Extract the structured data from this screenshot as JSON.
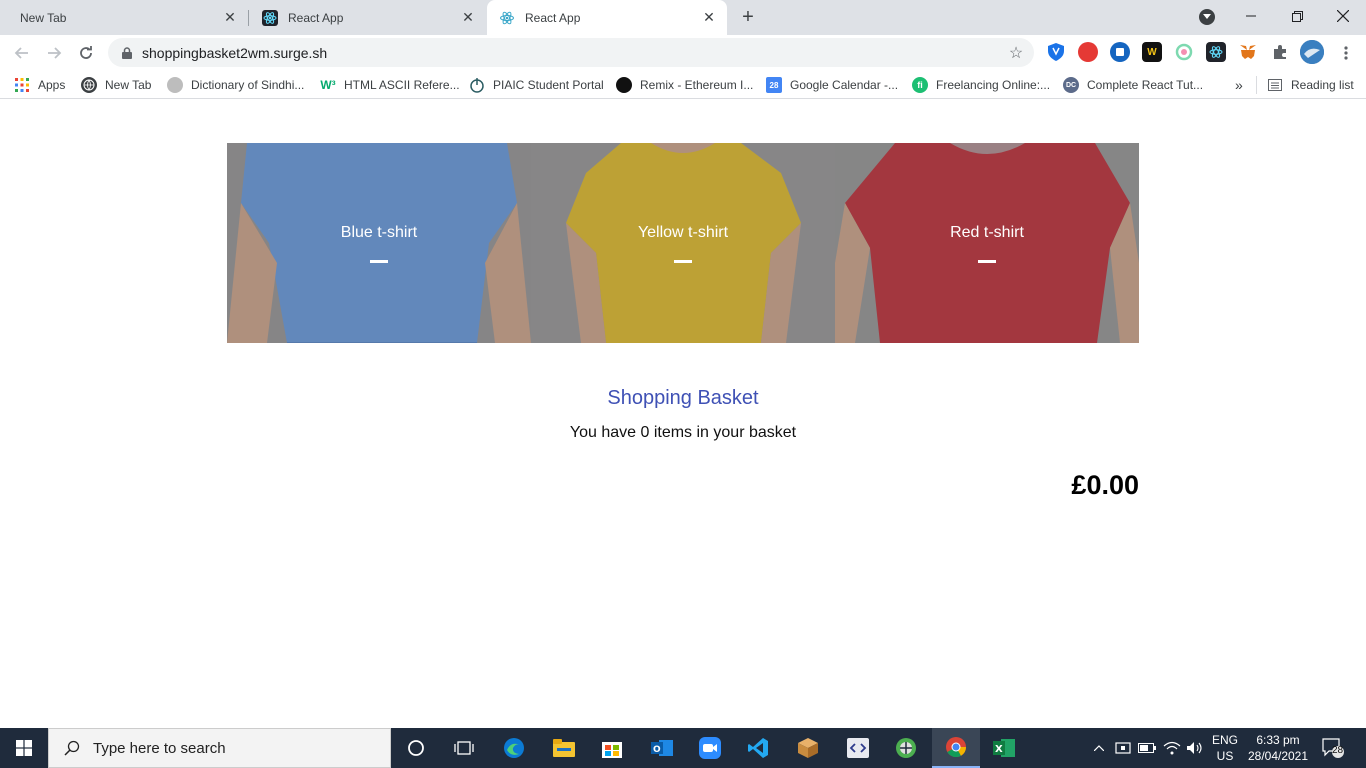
{
  "browser": {
    "tabs": [
      {
        "title": "New Tab",
        "active": false
      },
      {
        "title": "React App",
        "active": false
      },
      {
        "title": "React App",
        "active": true
      }
    ],
    "url": "shoppingbasket2wm.surge.sh",
    "bookmarks": [
      {
        "label": "Apps",
        "icon": "apps-grid-icon"
      },
      {
        "label": "New Tab",
        "icon": "globe-icon"
      },
      {
        "label": "Dictionary of Sindhi...",
        "icon": "dictionary-icon"
      },
      {
        "label": "HTML ASCII Refere...",
        "icon": "w3-icon"
      },
      {
        "label": "PIAIC Student Portal",
        "icon": "piaic-icon"
      },
      {
        "label": "Remix - Ethereum I...",
        "icon": "remix-icon"
      },
      {
        "label": "Google Calendar -...",
        "icon": "calendar-icon"
      },
      {
        "label": "Freelancing Online:...",
        "icon": "fiverr-icon"
      },
      {
        "label": "Complete React Tut...",
        "icon": "dc-icon"
      }
    ],
    "reading_list": "Reading list",
    "overflow": "»"
  },
  "page": {
    "products": [
      {
        "name": "Blue t-shirt",
        "color": "#5b8fd6"
      },
      {
        "name": "Yellow t-shirt",
        "color": "#d9b21c"
      },
      {
        "name": "Red t-shirt",
        "color": "#b51f2a"
      }
    ],
    "basket_title": "Shopping Basket",
    "basket_count_text": "You have 0 items in your basket",
    "basket_total": "£0.00"
  },
  "taskbar": {
    "search_placeholder": "Type here to search",
    "lang_line1": "ENG",
    "lang_line2": "US",
    "time": "6:33 pm",
    "date": "28/04/2021",
    "notifications": "28"
  }
}
